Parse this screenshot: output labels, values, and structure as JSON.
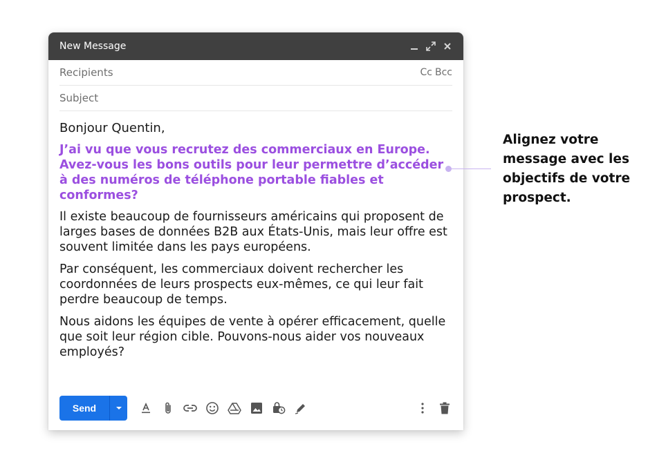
{
  "window": {
    "title": "New Message"
  },
  "fields": {
    "recipients_placeholder": "Recipients",
    "cc_label": "Cc",
    "bcc_label": "Bcc",
    "subject_placeholder": "Subject"
  },
  "message": {
    "greeting": "Bonjour Quentin,",
    "highlight": "J’ai vu que vous recrutez des commerciaux en Europe. Avez-vous les bons outils pour leur permettre d’accéder à des numéros de téléphone portable fiables et conformes?",
    "paragraphs": [
      "Il existe beaucoup de fournisseurs américains qui proposent de larges bases de données B2B aux États-Unis, mais leur offre est souvent limitée dans les pays européens.",
      "Par conséquent, les commerciaux doivent rechercher les coordonnées de leurs prospects eux-mêmes, ce qui leur fait perdre beaucoup de temps.",
      "Nous aidons les équipes de vente à opérer efficacement, quelle que soit leur région cible. Pouvons-nous aider vos nouveaux employés?"
    ]
  },
  "toolbar": {
    "send_label": "Send",
    "icons": [
      "format-text-icon",
      "attach-icon",
      "link-icon",
      "emoji-icon",
      "drive-icon",
      "image-icon",
      "confidential-icon",
      "signature-icon",
      "more-options-icon",
      "trash-icon"
    ]
  },
  "annotation": {
    "text": "Alignez votre message avec les objectifs de votre prospect."
  },
  "colors": {
    "titlebar": "#404040",
    "accent": "#9b4fe0",
    "send": "#1a73e8"
  }
}
